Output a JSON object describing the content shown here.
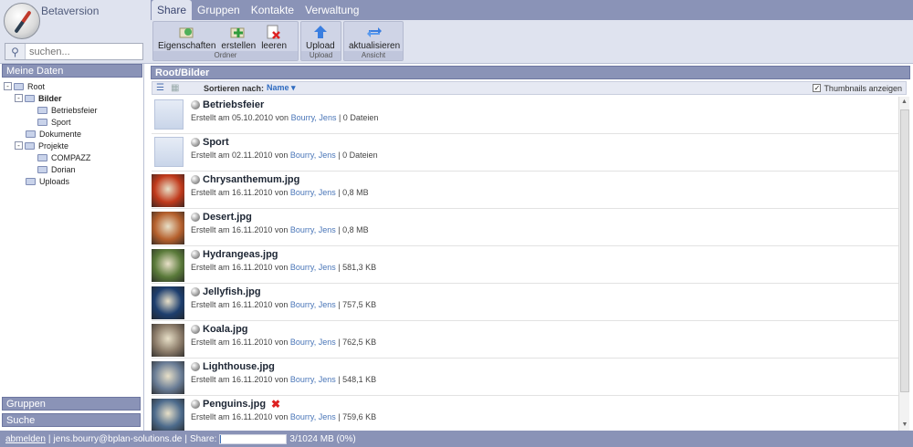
{
  "app": {
    "title": "Betaversion"
  },
  "search": {
    "placeholder": "suchen..."
  },
  "tabs": [
    {
      "label": "Share",
      "active": true
    },
    {
      "label": "Gruppen",
      "active": false
    },
    {
      "label": "Kontakte",
      "active": false
    },
    {
      "label": "Verwaltung",
      "active": false
    }
  ],
  "ribbon": {
    "groups": [
      {
        "name": "Ordner",
        "buttons": [
          {
            "label": "Eigenschaften",
            "icon": "folder-properties-icon"
          },
          {
            "label": "erstellen",
            "icon": "folder-add-icon"
          },
          {
            "label": "leeren",
            "icon": "clear-icon"
          }
        ]
      },
      {
        "name": "Upload",
        "buttons": [
          {
            "label": "Upload",
            "icon": "upload-arrow-icon"
          }
        ]
      },
      {
        "name": "Ansicht",
        "buttons": [
          {
            "label": "aktualisieren",
            "icon": "refresh-icon"
          }
        ]
      }
    ]
  },
  "sidebar": {
    "header": "Meine Daten",
    "tree": [
      {
        "label": "Root",
        "toggle": "-",
        "level": 0
      },
      {
        "label": "Bilder",
        "toggle": "-",
        "level": 1,
        "selected": true
      },
      {
        "label": "Betriebsfeier",
        "toggle": "",
        "level": 2
      },
      {
        "label": "Sport",
        "toggle": "",
        "level": 2
      },
      {
        "label": "Dokumente",
        "toggle": "",
        "level": 1
      },
      {
        "label": "Projekte",
        "toggle": "-",
        "level": 1
      },
      {
        "label": "COMPAZZ",
        "toggle": "",
        "level": 2
      },
      {
        "label": "Dorian",
        "toggle": "",
        "level": 2
      },
      {
        "label": "Uploads",
        "toggle": "",
        "level": 1
      }
    ],
    "groups_label": "Gruppen",
    "search_label": "Suche"
  },
  "main": {
    "path": "Root/Bilder",
    "sort_label": "Sortieren nach:",
    "sort_value": "Name ▾",
    "thumbs_label": "Thumbnails anzeigen",
    "thumbs_checked": true
  },
  "files": [
    {
      "name": "Betriebsfeier",
      "created": "Erstellt am 05.10.2010 von",
      "author": "Bourry, Jens",
      "size": "| 0 Dateien",
      "type": "folder"
    },
    {
      "name": "Sport",
      "created": "Erstellt am 02.11.2010 von",
      "author": "Bourry, Jens",
      "size": "| 0 Dateien",
      "type": "folder"
    },
    {
      "name": "Chrysanthemum.jpg",
      "created": "Erstellt am 16.11.2010 von",
      "author": "Bourry, Jens",
      "size": "| 0,8 MB",
      "type": "image",
      "thumb": "#c0391b"
    },
    {
      "name": "Desert.jpg",
      "created": "Erstellt am 16.11.2010 von",
      "author": "Bourry, Jens",
      "size": "| 0,8 MB",
      "type": "image",
      "thumb": "#b5602d"
    },
    {
      "name": "Hydrangeas.jpg",
      "created": "Erstellt am 16.11.2010 von",
      "author": "Bourry, Jens",
      "size": "| 581,3 KB",
      "type": "image",
      "thumb": "#5a7a3a"
    },
    {
      "name": "Jellyfish.jpg",
      "created": "Erstellt am 16.11.2010 von",
      "author": "Bourry, Jens",
      "size": "| 757,5 KB",
      "type": "image",
      "thumb": "#1d3e6e"
    },
    {
      "name": "Koala.jpg",
      "created": "Erstellt am 16.11.2010 von",
      "author": "Bourry, Jens",
      "size": "| 762,5 KB",
      "type": "image",
      "thumb": "#8a7a68"
    },
    {
      "name": "Lighthouse.jpg",
      "created": "Erstellt am 16.11.2010 von",
      "author": "Bourry, Jens",
      "size": "| 548,1 KB",
      "type": "image",
      "thumb": "#6a7d96"
    },
    {
      "name": "Penguins.jpg",
      "created": "Erstellt am 16.11.2010 von",
      "author": "Bourry, Jens",
      "size": "| 759,6 KB",
      "type": "image",
      "thumb": "#4d6b8c",
      "deletable": true
    }
  ],
  "status": {
    "logout": "abmelden",
    "user": "jens.bourry@bplan-solutions.de",
    "share_label": "Share:",
    "usage": "3/1024 MB (0%)",
    "usage_fraction": 0.003
  }
}
